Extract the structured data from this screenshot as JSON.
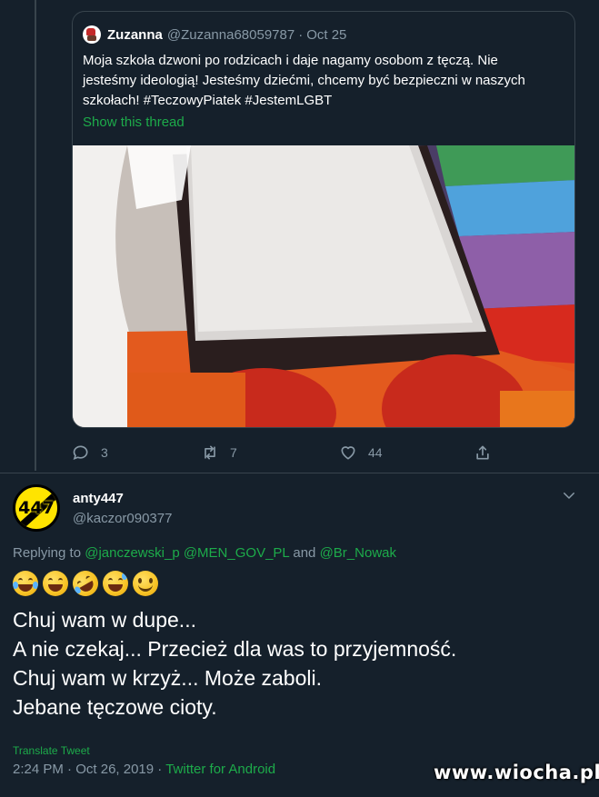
{
  "quoted_tweet": {
    "author_name": "Zuzanna",
    "author_handle": "@Zuzanna68059787",
    "separator": "·",
    "date": "Oct 25",
    "text_lines": [
      "Moja szkoła dzwoni po rodzicach i daje nagamy osobom z tęczą. Nie",
      "jesteśmy ideologią! Jesteśmy dziećmi, chcemy być bezpieczni w naszych",
      "szkołach! #TeczowyPiatek #JestemLGBT"
    ],
    "show_thread_label": "Show this thread"
  },
  "actions": {
    "reply_count": "3",
    "retweet_count": "7",
    "like_count": "44"
  },
  "tweet": {
    "author_name": "anty447",
    "author_handle": "@kaczor090377",
    "avatar_text": "447",
    "replying_prefix": "Replying to",
    "mentions": [
      "@janczewski_p",
      "@MEN_GOV_PL",
      "@Br_Nowak"
    ],
    "mention_joiner": "and",
    "emojis": [
      "face-with-tears-of-joy",
      "grinning-squinting-face",
      "rolling-on-floor-laughing",
      "grinning-face-with-sweat",
      "smiling-face"
    ],
    "lines": [
      "Chuj wam w dupe...",
      "A nie czekaj... Przecież dla was to przyjemność.",
      "Chuj wam w krzyż... Może zaboli.",
      "Jebane tęczowe cioty."
    ],
    "translate_label": "Translate Tweet",
    "time": "2:24 PM",
    "separator": "·",
    "date": "Oct 26, 2019",
    "source": "Twitter for Android"
  },
  "watermark": "www.wiocha.pl",
  "colors": {
    "background": "#15202b",
    "border": "#38444d",
    "muted": "#8899a6",
    "accent": "#1dab4a"
  }
}
